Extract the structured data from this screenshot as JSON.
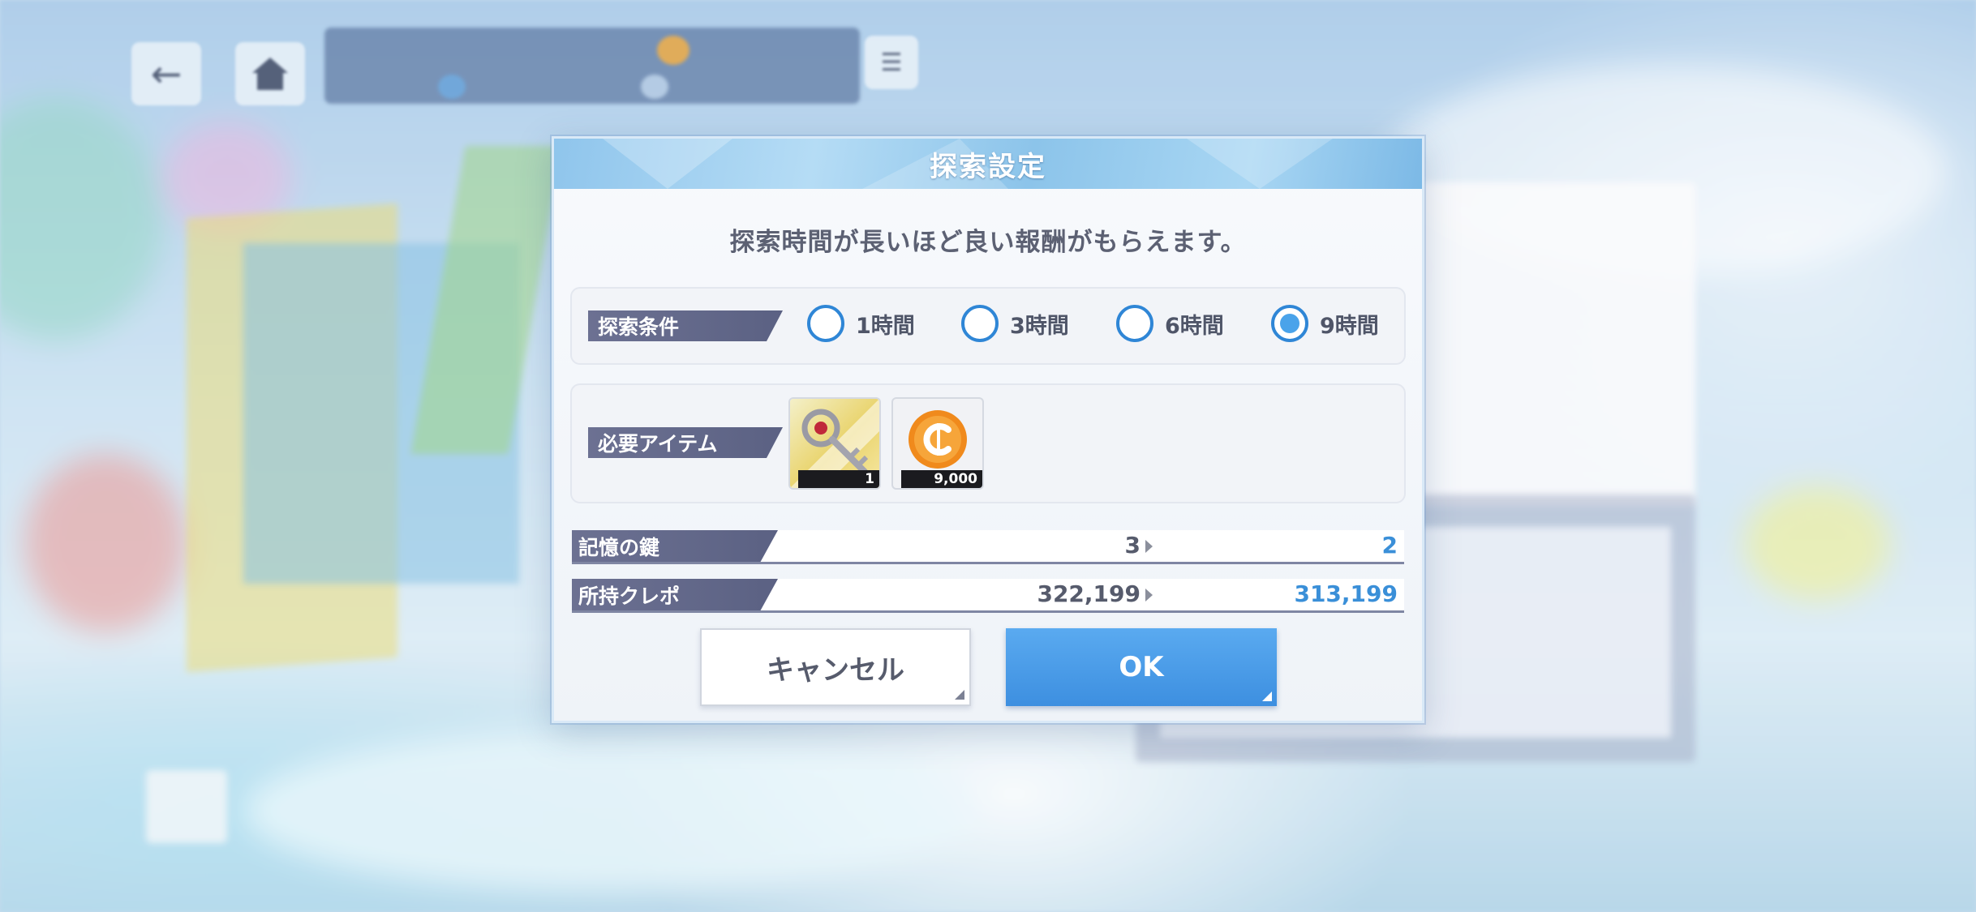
{
  "hud": {
    "back_icon": "arrow-left-icon",
    "home_icon": "home-icon"
  },
  "dialog": {
    "title": "探索設定",
    "message": "探索時間が長いほど良い報酬がもらえます。",
    "condition": {
      "label": "探索条件",
      "options": [
        {
          "label": "1時間",
          "checked": false
        },
        {
          "label": "3時間",
          "checked": false
        },
        {
          "label": "6時間",
          "checked": false
        },
        {
          "label": "9時間",
          "checked": true
        }
      ]
    },
    "required_items": {
      "label": "必要アイテム",
      "items": [
        {
          "icon": "key-icon",
          "count": "1"
        },
        {
          "icon": "coin-icon",
          "count": "9,000"
        }
      ]
    },
    "memory_key": {
      "label": "記憶の鍵",
      "current": "3",
      "after": "2"
    },
    "credits": {
      "label": "所持クレポ",
      "current": "322,199",
      "after": "313,199"
    },
    "cancel_label": "キャンセル",
    "ok_label": "OK"
  },
  "colors": {
    "accent": "#3d8fe0",
    "tag": "#5b6183",
    "value_new": "#3a8fd8"
  }
}
